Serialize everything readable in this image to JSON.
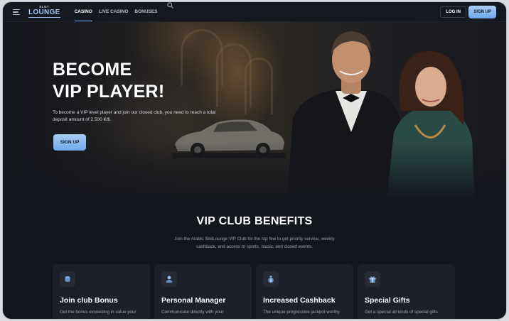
{
  "header": {
    "logo_top": "SLOT",
    "logo_main": "LOUNGE",
    "nav": [
      {
        "label": "CASINO",
        "active": true
      },
      {
        "label": "LIVE CASINO",
        "active": false
      },
      {
        "label": "BONUSES",
        "active": false
      }
    ],
    "login_label": "LOG IN",
    "signup_label": "SIGN UP"
  },
  "hero": {
    "title_line1": "BECOME",
    "title_line2": "VIP PLAYER!",
    "text": "To become a VIP level player and join our closed club, you need to reach a total deposit amount of 2 500 €/$.",
    "signup_label": "SIGN UP"
  },
  "benefits": {
    "title": "VIP CLUB BENEFITS",
    "subtitle": "Join the Arabic SlotLounge VIP Club for the top few to get priority service, weekly cashback, and access to sports, music, and closed events.",
    "cards": [
      {
        "icon": "coins-icon",
        "title": "Join club Bonus",
        "text": "Get the bonus exceeding in value your"
      },
      {
        "icon": "manager-icon",
        "title": "Personal Manager",
        "text": "Communicate directly with your"
      },
      {
        "icon": "money-bag-icon",
        "title": "Increased Cashback",
        "text": "The unique progressive jackpot worthy"
      },
      {
        "icon": "gift-icon",
        "title": "Special Gifts",
        "text": "Get a special all kinds of special gifts"
      }
    ]
  },
  "colors": {
    "accent": "#6fa8e8",
    "background": "#14161d",
    "card": "#1d2029"
  }
}
